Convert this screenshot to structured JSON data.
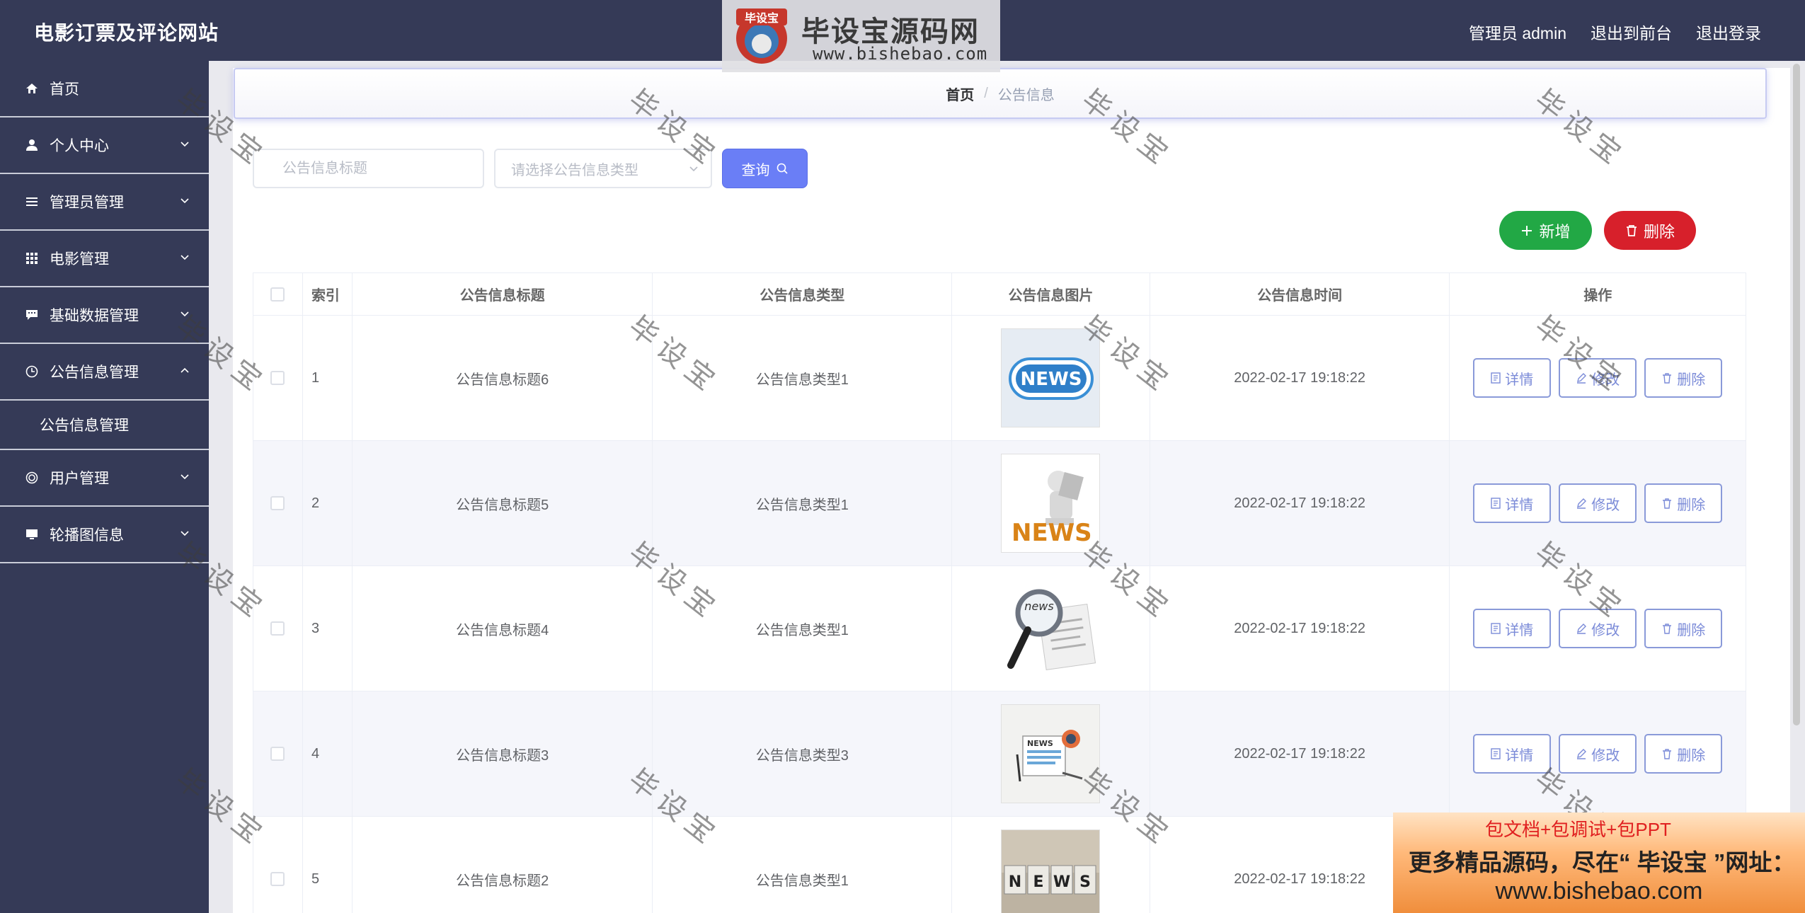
{
  "header": {
    "app_title": "电影订票及评论网站",
    "user_label": "管理员 admin",
    "front_label": "退出到前台",
    "logout_label": "退出登录"
  },
  "logo_banner": {
    "mark_text": "毕设宝",
    "title": "毕设宝源码网",
    "url": "www.bishebao.com"
  },
  "sidebar": {
    "items": [
      {
        "label": "首页",
        "icon": "home-icon",
        "expandable": false
      },
      {
        "label": "个人中心",
        "icon": "user-icon",
        "expandable": true
      },
      {
        "label": "管理员管理",
        "icon": "list-icon",
        "expandable": true
      },
      {
        "label": "电影管理",
        "icon": "grid-icon",
        "expandable": true
      },
      {
        "label": "基础数据管理",
        "icon": "chat-icon",
        "expandable": true
      },
      {
        "label": "公告信息管理",
        "icon": "clock-icon",
        "expandable": true,
        "open": true,
        "children": [
          "公告信息管理"
        ]
      },
      {
        "label": "用户管理",
        "icon": "target-icon",
        "expandable": true
      },
      {
        "label": "轮播图信息",
        "icon": "monitor-icon",
        "expandable": true
      }
    ]
  },
  "breadcrumb": {
    "home": "首页",
    "separator": "/",
    "current": "公告信息"
  },
  "search": {
    "title_placeholder": "公告信息标题",
    "type_placeholder": "请选择公告信息类型",
    "query_label": "查询"
  },
  "actions": {
    "add_label": "新增",
    "delete_label": "删除"
  },
  "table": {
    "headers": [
      "索引",
      "公告信息标题",
      "公告信息类型",
      "公告信息图片",
      "公告信息时间",
      "操作"
    ],
    "rows": [
      {
        "index": "1",
        "title": "公告信息标题6",
        "type": "公告信息类型1",
        "image": "news-badge-image",
        "time": "2022-02-17 19:18:22"
      },
      {
        "index": "2",
        "title": "公告信息标题5",
        "type": "公告信息类型1",
        "image": "news-reader-image",
        "time": "2022-02-17 19:18:22"
      },
      {
        "index": "3",
        "title": "公告信息标题4",
        "type": "公告信息类型1",
        "image": "news-magnifier-image",
        "time": "2022-02-17 19:18:22"
      },
      {
        "index": "4",
        "title": "公告信息标题3",
        "type": "公告信息类型3",
        "image": "news-flat-image",
        "time": "2022-02-17 19:18:22"
      },
      {
        "index": "5",
        "title": "公告信息标题2",
        "type": "公告信息类型1",
        "image": "news-cubes-image",
        "time": "2022-02-17 19:18:22"
      }
    ],
    "op_detail": "详情",
    "op_edit": "修改",
    "op_delete": "删除"
  },
  "watermark_text": "毕设宝",
  "promo": {
    "line1": "包文档+包调试+包PPT",
    "line2": "更多精品源码，尽在“ 毕设宝 ”网址：",
    "line3": "www.bishebao.com"
  },
  "colors": {
    "sidebar_bg": "#353a57",
    "primary": "#6a7ef6",
    "success": "#22a845",
    "danger": "#d7202b"
  }
}
